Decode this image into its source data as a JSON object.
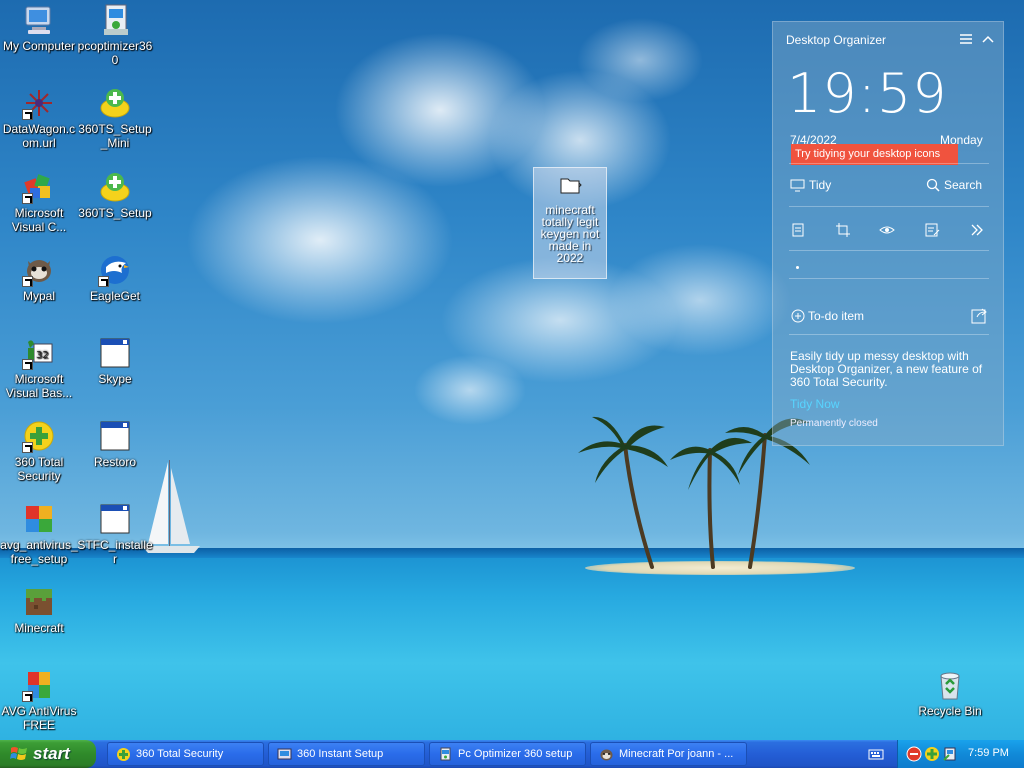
{
  "desktop": {
    "icons_col1": [
      {
        "label": "My Computer",
        "icon": "my-computer-icon"
      },
      {
        "label": "DataWagon.com.url",
        "icon": "datawagon-icon"
      },
      {
        "label": "Microsoft Visual C...",
        "icon": "visual-c-icon"
      },
      {
        "label": "Mypal",
        "icon": "mypal-icon"
      },
      {
        "label": "Microsoft Visual Bas...",
        "icon": "visual-basic-icon"
      },
      {
        "label": "360 Total Security",
        "icon": "total-security-icon"
      },
      {
        "label": "avg_antivirus_free_setup",
        "icon": "avg-setup-icon"
      },
      {
        "label": "Minecraft",
        "icon": "minecraft-icon"
      },
      {
        "label": "AVG AntiVirus FREE",
        "icon": "avg-icon"
      }
    ],
    "icons_col2": [
      {
        "label": "pcoptimizer360",
        "icon": "pcoptimizer-icon"
      },
      {
        "label": "360TS_Setup_Mini",
        "icon": "360ts-setup-mini-icon"
      },
      {
        "label": "360TS_Setup",
        "icon": "360ts-setup-icon"
      },
      {
        "label": "EagleGet",
        "icon": "eagleget-icon"
      },
      {
        "label": "Skype",
        "icon": "skype-icon"
      },
      {
        "label": "Restoro",
        "icon": "restoro-icon"
      },
      {
        "label": "STFC_installer",
        "icon": "stfc-installer-icon"
      }
    ],
    "selected_folder": {
      "label": "minecraft totally legit keygen not made in 2022"
    },
    "recycle_bin": {
      "label": "Recycle Bin"
    }
  },
  "organizer": {
    "title": "Desktop Organizer",
    "time": "19:59",
    "date": "7/4/2022",
    "day": "Monday",
    "tooltip": "Try tidying your desktop icons",
    "tidy_label": "Tidy",
    "search_label": "Search",
    "todo_label": "To-do item",
    "description": "Easily tidy up messy desktop with Desktop Organizer, a new feature of 360 Total Security.",
    "tidy_now": "Tidy Now",
    "permanently_closed": "Permanently closed"
  },
  "taskbar": {
    "start_label": "start",
    "tasks": [
      {
        "label": "360 Total Security"
      },
      {
        "label": "360 Instant Setup"
      },
      {
        "label": "Pc Optimizer 360 setup"
      },
      {
        "label": "Minecraft Por joann - ..."
      }
    ],
    "clock": "7:59 PM"
  },
  "colors": {
    "tooltip": "#f0533e",
    "tidy_now": "#58d4ff",
    "taskbar": "#245ed6",
    "start": "#2f8a2a",
    "tray": "#118ad8"
  }
}
